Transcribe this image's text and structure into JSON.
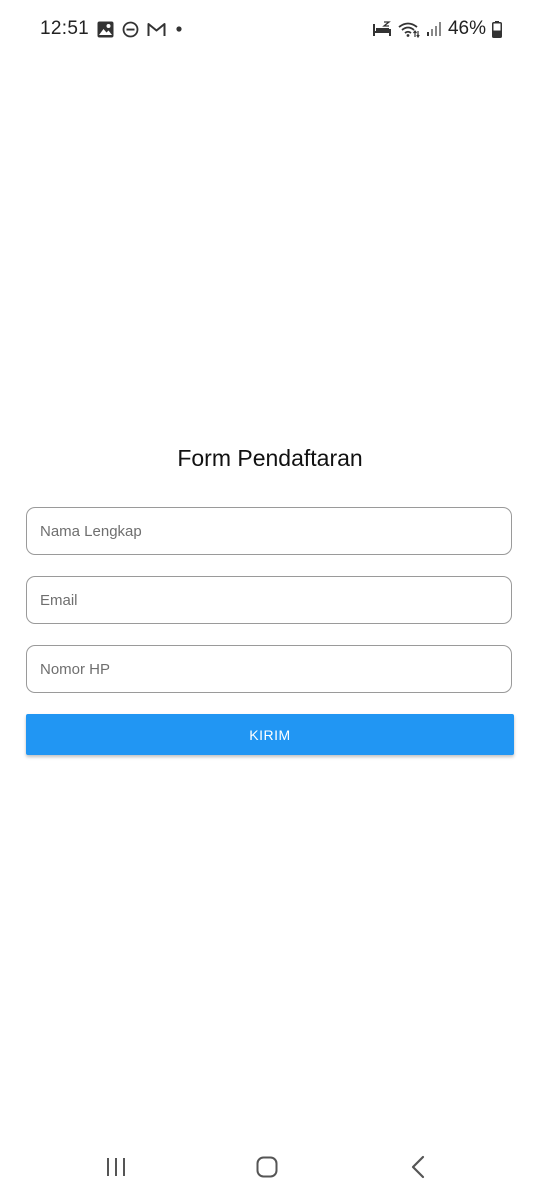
{
  "status_bar": {
    "time": "12:51",
    "battery_percent": "46%",
    "battery_level": 0.46,
    "notification_icons": [
      "image-icon",
      "do-not-disturb-icon",
      "gmail-icon",
      "dot-icon"
    ],
    "system_icons": [
      "sleep-mode-icon",
      "wifi-icon",
      "signal-icon",
      "battery-icon"
    ]
  },
  "form": {
    "title": "Form Pendaftaran",
    "fields": {
      "nama": {
        "placeholder": "Nama Lengkap",
        "value": ""
      },
      "email": {
        "placeholder": "Email",
        "value": ""
      },
      "hp": {
        "placeholder": "Nomor HP",
        "value": ""
      }
    },
    "submit_label": "KIRIM",
    "button_color": "#2196f3"
  },
  "nav_bar": {
    "icons": [
      "recents-icon",
      "home-icon",
      "back-icon"
    ]
  }
}
